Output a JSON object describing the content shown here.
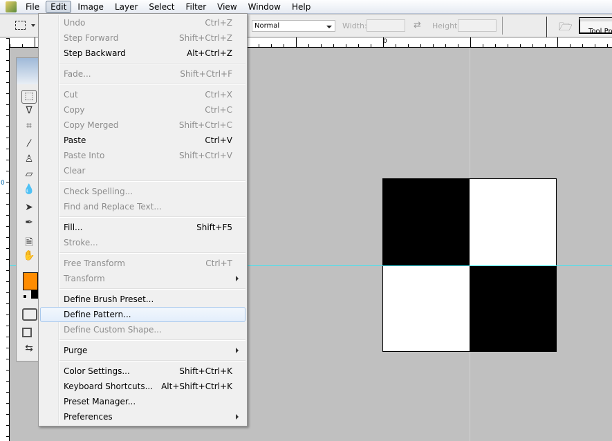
{
  "menubar": {
    "items": [
      "File",
      "Edit",
      "Image",
      "Layer",
      "Select",
      "Filter",
      "View",
      "Window",
      "Help"
    ],
    "active": "Edit"
  },
  "options": {
    "style_value": "Normal",
    "width_label": "Width:",
    "height_label": "Height:",
    "tool_presets_tab": "Tool Presets"
  },
  "rulers": {
    "top_zero": "0",
    "left_zero": "0"
  },
  "colors": {
    "foreground": "#ff8c00",
    "background": "#000000",
    "guide": "#3fe3f0"
  },
  "edit_menu": [
    {
      "label": "Undo",
      "shortcut": "Ctrl+Z",
      "enabled": false
    },
    {
      "label": "Step Forward",
      "shortcut": "Shift+Ctrl+Z",
      "enabled": false
    },
    {
      "label": "Step Backward",
      "shortcut": "Alt+Ctrl+Z",
      "enabled": true
    },
    {
      "sep": true
    },
    {
      "label": "Fade...",
      "shortcut": "Shift+Ctrl+F",
      "enabled": false
    },
    {
      "sep": true
    },
    {
      "label": "Cut",
      "shortcut": "Ctrl+X",
      "enabled": false
    },
    {
      "label": "Copy",
      "shortcut": "Ctrl+C",
      "enabled": false
    },
    {
      "label": "Copy Merged",
      "shortcut": "Shift+Ctrl+C",
      "enabled": false
    },
    {
      "label": "Paste",
      "shortcut": "Ctrl+V",
      "enabled": true
    },
    {
      "label": "Paste Into",
      "shortcut": "Shift+Ctrl+V",
      "enabled": false
    },
    {
      "label": "Clear",
      "shortcut": "",
      "enabled": false
    },
    {
      "sep": true
    },
    {
      "label": "Check Spelling...",
      "shortcut": "",
      "enabled": false
    },
    {
      "label": "Find and Replace Text...",
      "shortcut": "",
      "enabled": false
    },
    {
      "sep": true
    },
    {
      "label": "Fill...",
      "shortcut": "Shift+F5",
      "enabled": true
    },
    {
      "label": "Stroke...",
      "shortcut": "",
      "enabled": false
    },
    {
      "sep": true
    },
    {
      "label": "Free Transform",
      "shortcut": "Ctrl+T",
      "enabled": false
    },
    {
      "label": "Transform",
      "shortcut": "",
      "enabled": false,
      "submenu": true
    },
    {
      "sep": true
    },
    {
      "label": "Define Brush Preset...",
      "shortcut": "",
      "enabled": true
    },
    {
      "label": "Define Pattern...",
      "shortcut": "",
      "enabled": true,
      "highlighted": true
    },
    {
      "label": "Define Custom Shape...",
      "shortcut": "",
      "enabled": false
    },
    {
      "sep": true
    },
    {
      "label": "Purge",
      "shortcut": "",
      "enabled": true,
      "submenu": true
    },
    {
      "sep": true
    },
    {
      "label": "Color Settings...",
      "shortcut": "Shift+Ctrl+K",
      "enabled": true
    },
    {
      "label": "Keyboard Shortcuts...",
      "shortcut": "Alt+Shift+Ctrl+K",
      "enabled": true
    },
    {
      "label": "Preset Manager...",
      "shortcut": "",
      "enabled": true
    },
    {
      "label": "Preferences",
      "shortcut": "",
      "enabled": true,
      "submenu": true
    }
  ]
}
